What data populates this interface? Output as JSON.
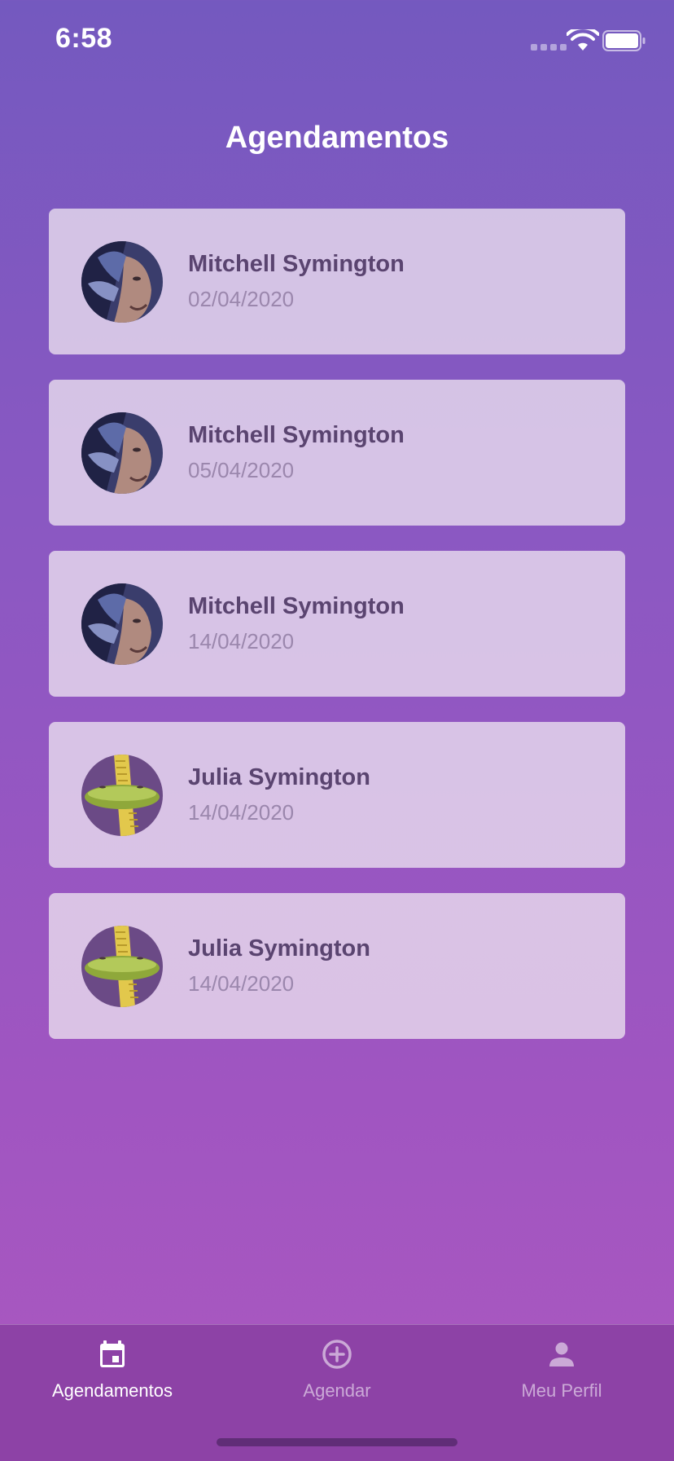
{
  "status_bar": {
    "time": "6:58",
    "icons": [
      "cellular-signal-icon",
      "wifi-icon",
      "battery-icon"
    ]
  },
  "header": {
    "title": "Agendamentos"
  },
  "appointments": [
    {
      "name": "Mitchell Symington",
      "date": "02/04/2020",
      "avatar": "avatar-mitchell"
    },
    {
      "name": "Mitchell Symington",
      "date": "05/04/2020",
      "avatar": "avatar-mitchell"
    },
    {
      "name": "Mitchell Symington",
      "date": "14/04/2020",
      "avatar": "avatar-mitchell"
    },
    {
      "name": "Julia Symington",
      "date": "14/04/2020",
      "avatar": "avatar-julia"
    },
    {
      "name": "Julia Symington",
      "date": "14/04/2020",
      "avatar": "avatar-julia"
    }
  ],
  "tab_bar": {
    "active": "Agendamentos",
    "tabs": [
      {
        "label": "Agendamentos",
        "icon": "calendar-icon"
      },
      {
        "label": "Agendar",
        "icon": "plus-circle-icon"
      },
      {
        "label": "Meu Perfil",
        "icon": "person-icon"
      }
    ]
  },
  "colors": {
    "background_top": "#7459bf",
    "background_bottom": "#ab58c0",
    "card": "#e4d4ea",
    "name_text": "#5a4470",
    "date_text": "#9b87ad",
    "tab_bar": "#8d42a6"
  }
}
